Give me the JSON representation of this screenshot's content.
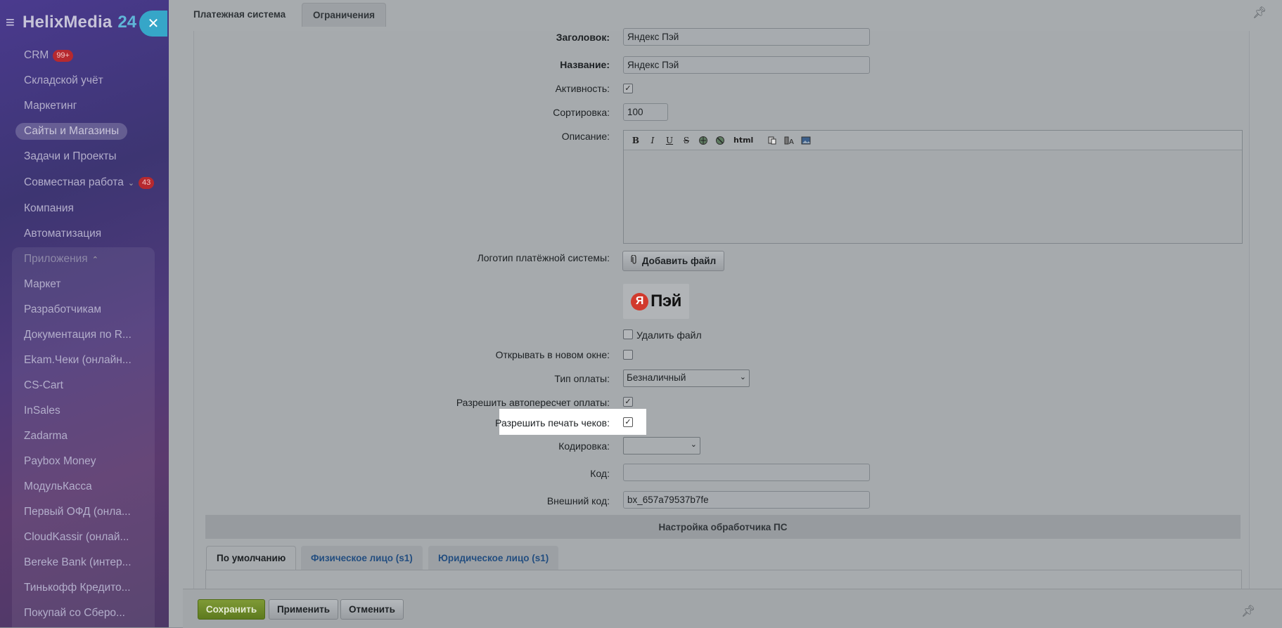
{
  "sidebar": {
    "brand": "HelixMedia",
    "brand_num": "24",
    "close_icon": "✕",
    "items": [
      {
        "label": "CRM",
        "badge": "99+"
      },
      {
        "label": "Складской учёт"
      },
      {
        "label": "Маркетинг"
      },
      {
        "label": "Сайты и Магазины",
        "active": true
      },
      {
        "label": "Задачи и Проекты"
      },
      {
        "label": "Совместная работа",
        "badge": "43"
      },
      {
        "label": "Компания"
      },
      {
        "label": "Автоматизация"
      },
      {
        "label": "Приложения"
      },
      {
        "label": "Маркет"
      },
      {
        "label": "Разработчикам"
      },
      {
        "label": "Документация по R..."
      },
      {
        "label": "Ekam.Чеки (онлайн..."
      },
      {
        "label": "CS-Cart"
      },
      {
        "label": "InSales"
      },
      {
        "label": "Zadarma"
      },
      {
        "label": "Paybox Money"
      },
      {
        "label": "МодульКасса"
      },
      {
        "label": "Первый ОФД (онла..."
      },
      {
        "label": "CloudKassir (онлай..."
      },
      {
        "label": "Bereke Bank (интер..."
      },
      {
        "label": "Тинькофф Кредито..."
      },
      {
        "label": "Покупай со Сберо..."
      }
    ]
  },
  "tabs": {
    "payment_system": "Платежная система",
    "limits": "Ограничения"
  },
  "form": {
    "header_label": "Заголовок:",
    "header_value": "Яндекс Пэй",
    "name_label": "Название:",
    "name_value": "Яндекс Пэй",
    "active_label": "Активность:",
    "sort_label": "Сортировка:",
    "sort_value": "100",
    "description_label": "Описание:",
    "logo_label": "Логотип платёжной системы:",
    "add_file_button": "Добавить файл",
    "logo_text_ya": "Я",
    "logo_text_pay": "Пэй",
    "delete_file_label": "Удалить файл",
    "new_window_label": "Открывать в новом окне:",
    "pay_type_label": "Тип оплаты:",
    "pay_type_value": "Безналичный",
    "auto_recalc_label": "Разрешить автопересчет оплаты:",
    "print_checks_label": "Разрешить печать чеков:",
    "encoding_label": "Кодировка:",
    "encoding_value": "",
    "code_label": "Код:",
    "code_value": "",
    "external_code_label": "Внешний код:",
    "external_code_value": "bx_657a79537b7fe"
  },
  "editor_toolbar": {
    "bold": "B",
    "italic": "I",
    "underline": "U",
    "strike": "S",
    "html": "html"
  },
  "section": {
    "handler_settings": "Настройка обработчика ПС"
  },
  "sub_tabs": {
    "default": "По умолчанию",
    "physical": "Физическое лицо (s1)",
    "legal": "Юридическое лицо (s1)"
  },
  "buttons": {
    "save": "Сохранить",
    "apply": "Применить",
    "cancel": "Отменить"
  }
}
